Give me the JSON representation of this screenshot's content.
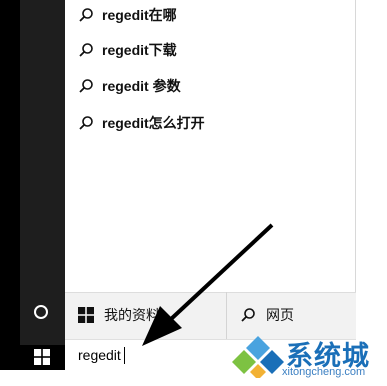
{
  "suggestions": [
    {
      "label": "regedit在哪",
      "icon": "search-icon"
    },
    {
      "label": "regedit下载",
      "icon": "search-icon"
    },
    {
      "label": "regedit 参数",
      "icon": "search-icon"
    },
    {
      "label": "regedit怎么打开",
      "icon": "search-icon"
    }
  ],
  "footer": {
    "my_stuff_label": "我的资料",
    "my_stuff_icon": "windows-icon",
    "web_label": "网页",
    "web_icon": "search-icon"
  },
  "search": {
    "value": "regedit"
  },
  "watermark": {
    "brand": "系统城",
    "url": "xitongcheng.com",
    "colors": {
      "blue": "#1a6fb8",
      "green": "#7dc242",
      "light_blue": "#4aa3df"
    }
  },
  "colors": {
    "rail": "#1e1e1e",
    "taskbar": "#000000",
    "panel": "#ffffff",
    "footer": "#f2f2f2"
  }
}
